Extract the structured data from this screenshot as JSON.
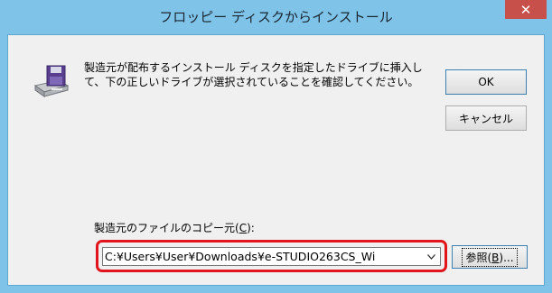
{
  "window": {
    "title": "フロッピー ディスクからインストール",
    "close_glyph": "✕"
  },
  "icons": {
    "disk": "floppy-disk-drive-icon",
    "close": "close-icon",
    "dropdown": "chevron-down-icon"
  },
  "dialog": {
    "instruction": "製造元が配布するインストール ディスクを指定したドライブに挿入して、下の正しいドライブが選択されていることを確認してください。",
    "ok_label": "OK",
    "cancel_label": "キャンセル",
    "copy_from_label_prefix": "製造元のファイルのコピー元(",
    "copy_from_label_key": "C",
    "copy_from_label_suffix": "):",
    "path_value": "C:¥Users¥User¥Downloads¥e-STUDIO263CS_Wi",
    "browse_label_prefix": "参照(",
    "browse_label_key": "B",
    "browse_label_suffix": ")..."
  },
  "colors": {
    "titlebar": "#7fc3e8",
    "close_button": "#c7504a",
    "highlight": "#e0141a",
    "client_bg": "#f0f0f0"
  }
}
